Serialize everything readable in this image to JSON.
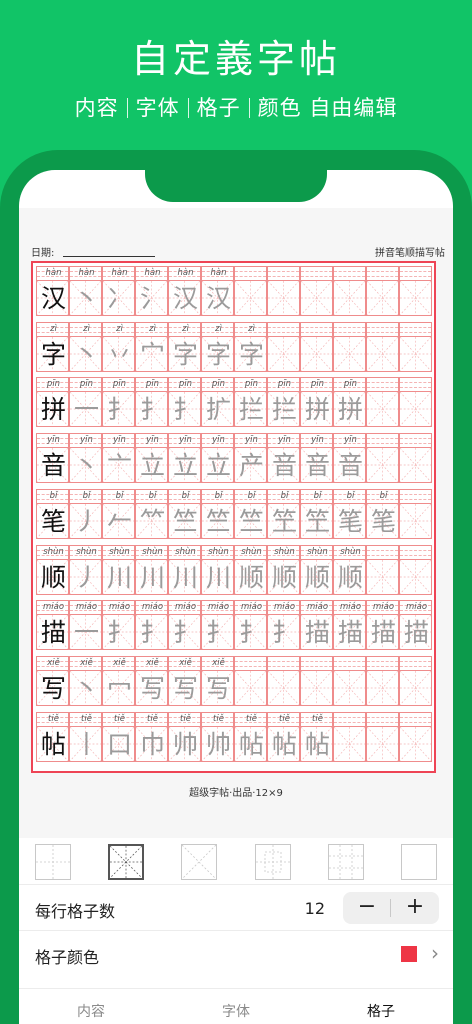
{
  "promo": {
    "title": "自定義字帖",
    "subtitle": [
      "内容",
      "字体",
      "格子",
      "颜色 自由编辑"
    ]
  },
  "paper": {
    "date_label": "日期:",
    "description": "拼音笔顺描写帖",
    "footer": "超级字帖·出品·12×9"
  },
  "sheet": {
    "columns": 12,
    "rows": [
      {
        "pinyin": "hàn",
        "cells": [
          "汉",
          "丶",
          "冫",
          "氵",
          "汉",
          "汉"
        ]
      },
      {
        "pinyin": "zì",
        "cells": [
          "字",
          "丶",
          "丷",
          "宀",
          "字",
          "字",
          "字"
        ]
      },
      {
        "pinyin": "pīn",
        "cells": [
          "拼",
          "一",
          "扌",
          "扌",
          "扌",
          "扩",
          "拦",
          "拦",
          "拼",
          "拼"
        ]
      },
      {
        "pinyin": "yīn",
        "cells": [
          "音",
          "丶",
          "亠",
          "立",
          "立",
          "立",
          "产",
          "音",
          "音",
          "音"
        ]
      },
      {
        "pinyin": "bǐ",
        "cells": [
          "笔",
          "丿",
          "𠂉",
          "𥫗",
          "竺",
          "竺",
          "竺",
          "笁",
          "笁",
          "笔",
          "笔"
        ]
      },
      {
        "pinyin": "shùn",
        "cells": [
          "顺",
          "丿",
          "川",
          "川",
          "川",
          "川",
          "顺",
          "顺",
          "顺",
          "顺"
        ]
      },
      {
        "pinyin": "miáo",
        "cells": [
          "描",
          "一",
          "扌",
          "扌",
          "扌",
          "扌",
          "扌",
          "扌",
          "描",
          "描",
          "描",
          "描"
        ]
      },
      {
        "pinyin": "xiě",
        "cells": [
          "写",
          "丶",
          "冖",
          "写",
          "写",
          "写"
        ]
      },
      {
        "pinyin": "tiě",
        "cells": [
          "帖",
          "丨",
          "口",
          "巾",
          "帅",
          "帅",
          "帖",
          "帖",
          "帖"
        ]
      }
    ]
  },
  "grid_types": [
    {
      "name": "tian",
      "selected": false
    },
    {
      "name": "mi",
      "selected": true
    },
    {
      "name": "cross",
      "selected": false
    },
    {
      "name": "hui",
      "selected": false
    },
    {
      "name": "jiu",
      "selected": false
    },
    {
      "name": "blank",
      "selected": false
    }
  ],
  "settings": {
    "per_row_label": "每行格子数",
    "per_row_value": "12",
    "minus": "−",
    "plus": "+",
    "color_label": "格子颜色",
    "grid_color": "#ee3545",
    "chevron": "›"
  },
  "tabs": [
    {
      "label": "内容",
      "active": false
    },
    {
      "label": "字体",
      "active": false
    },
    {
      "label": "格子",
      "active": true
    }
  ]
}
